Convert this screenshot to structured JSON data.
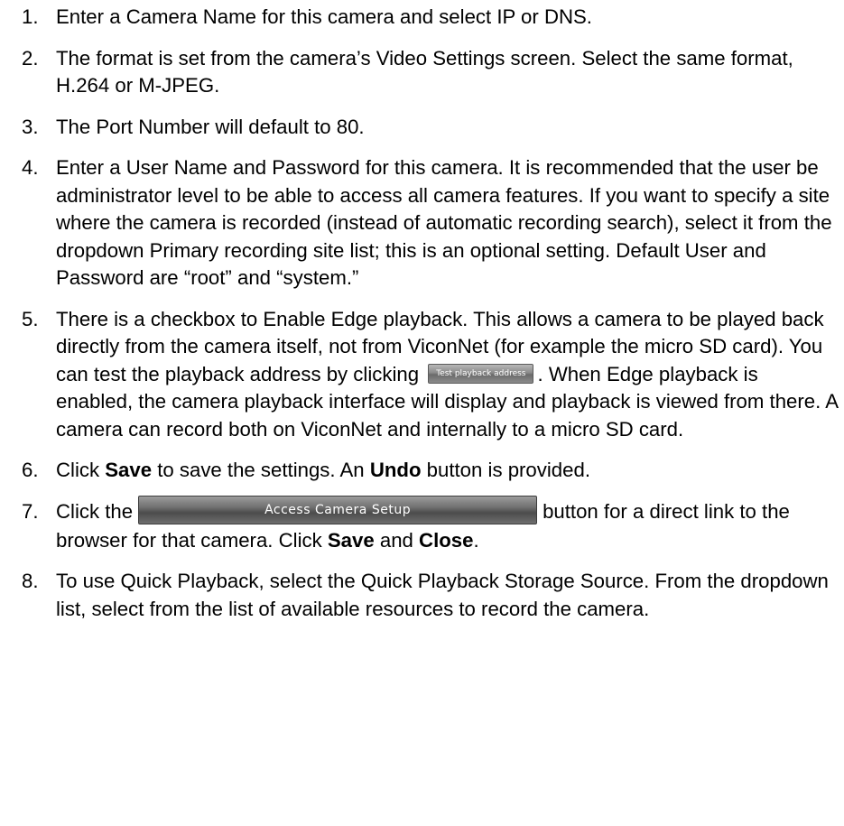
{
  "steps": [
    {
      "num": "1.",
      "text": "Enter a Camera Name for this camera and select IP or DNS."
    },
    {
      "num": "2.",
      "text": "The format is set from the camera’s Video Settings screen. Select the same format, H.264 or M-JPEG."
    },
    {
      "num": "3.",
      "text": "The Port Number will default to 80."
    },
    {
      "num": "4.",
      "text": "Enter a User Name and Password for this camera. It is recommended that the user be administrator level to be able to access all camera features. If you want to specify a site where the camera is recorded (instead of automatic recording search), select it from the dropdown Primary recording site list; this is an optional setting. Default User and Password are “root” and “system.”"
    },
    {
      "num": "5.",
      "text_before": "There is a checkbox to Enable Edge playback. This allows a camera to be played back directly from the camera itself, not from ViconNet (for example the micro SD card). You can test the playback address by clicking",
      "button_label": "Test playback address",
      "text_after": ". When Edge playback is enabled, the camera playback interface will display and playback is viewed from there. A camera can record both on ViconNet and internally to a micro SD card."
    },
    {
      "num": "6.",
      "part1": "Click ",
      "bold1": "Save",
      "part2": " to save the settings. An ",
      "bold2": "Undo",
      "part3": " button is provided."
    },
    {
      "num": "7.",
      "part1": "Click the",
      "button_label": "Access Camera Setup",
      "part2": "button for a direct link to the browser for that camera. Click ",
      "bold1": "Save",
      "part3": " and ",
      "bold2": "Close",
      "part4": "."
    },
    {
      "num": "8.",
      "text": "To use Quick Playback, select the Quick Playback Storage Source. From the dropdown list, select from the list of available resources to record the camera."
    }
  ]
}
